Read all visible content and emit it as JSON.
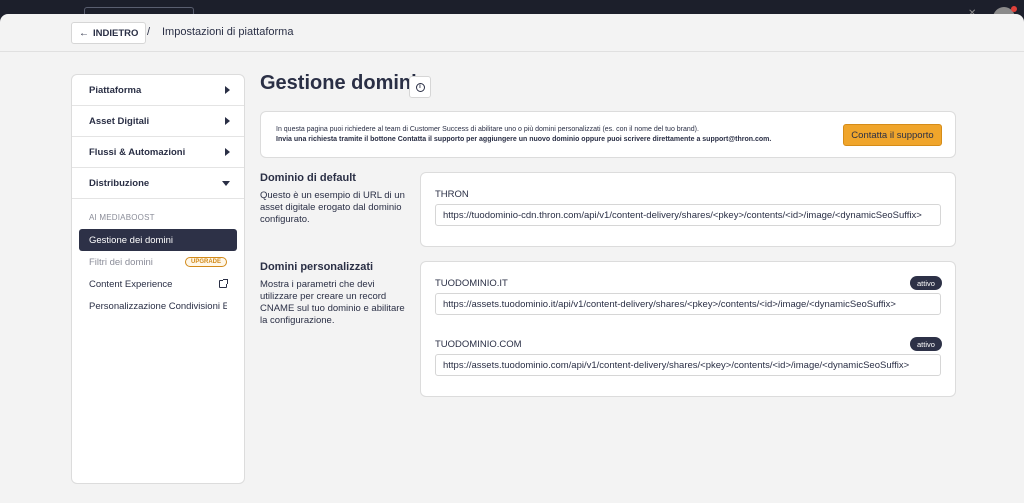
{
  "header": {
    "back_label": "INDIETRO",
    "separator": "/",
    "breadcrumb": "Impostazioni di piattaforma"
  },
  "sidebar": {
    "items": [
      {
        "label": "Piattaforma",
        "state": "collapsed"
      },
      {
        "label": "Asset Digitali",
        "state": "collapsed"
      },
      {
        "label": "Flussi & Automazioni",
        "state": "collapsed"
      },
      {
        "label": "Distribuzione",
        "state": "expanded"
      }
    ],
    "section_label": "AI MEDIABOOST",
    "sub_items": [
      {
        "label": "Gestione dei domini",
        "active": true
      },
      {
        "label": "Filtri dei domini",
        "badge": "UPGRADE"
      },
      {
        "label": "Content Experience",
        "icon": "external-link-icon"
      },
      {
        "label": "Personalizzazione Condivisioni E..."
      }
    ]
  },
  "main": {
    "title": "Gestione domini",
    "notice": {
      "line1": "In questa pagina puoi richiedere al team di Customer Success di abilitare uno o più domini personalizzati (es. con il nome del tuo brand).",
      "line2": "Invia una richiesta tramite il bottone Contatta il supporto per aggiungere un nuovo dominio oppure puoi scrivere direttamente a support@thron.com.",
      "button": "Contatta il supporto"
    },
    "default_domain": {
      "title": "Dominio di default",
      "description": "Questo è un esempio di URL di un asset digitale erogato dal dominio configurato.",
      "label": "THRON",
      "url": "https://tuodominio-cdn.thron.com/api/v1/content-delivery/shares/<pkey>/contents/<id>/image/<dynamicSeoSuffix>"
    },
    "custom_domains": {
      "title": "Domini personalizzati",
      "description": "Mostra i parametri che devi utilizzare per creare un record CNAME sul tuo dominio e abilitare la configurazione.",
      "items": [
        {
          "label": "TUODOMINIO.IT",
          "status": "attivo",
          "url": "https://assets.tuodominio.it/api/v1/content-delivery/shares/<pkey>/contents/<id>/image/<dynamicSeoSuffix>"
        },
        {
          "label": "TUODOMINIO.COM",
          "status": "attivo",
          "url": "https://assets.tuodominio.com/api/v1/content-delivery/shares/<pkey>/contents/<id>/image/<dynamicSeoSuffix>"
        }
      ]
    }
  },
  "colors": {
    "accent": "#f0a52b",
    "active_bg": "#2d3147",
    "page_bg": "#f3f3f3",
    "upgrade": "#d28a1a"
  }
}
